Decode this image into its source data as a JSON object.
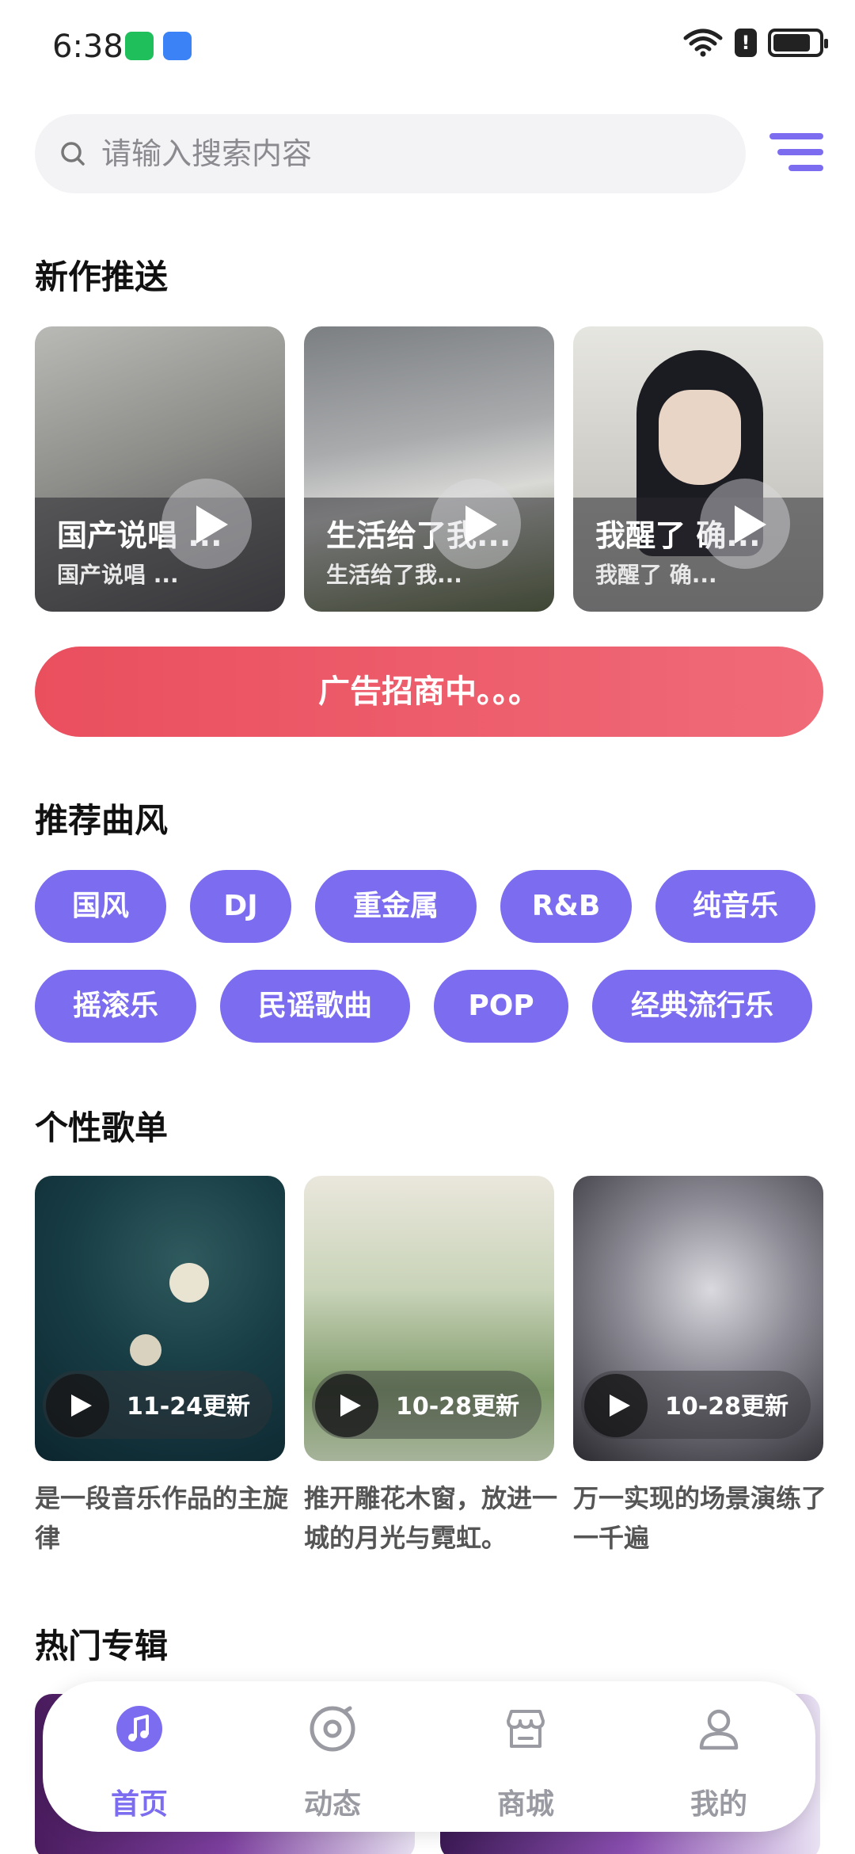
{
  "status_bar": {
    "time": "6:38"
  },
  "search": {
    "placeholder": "请输入搜索内容"
  },
  "sections": {
    "new_works": "新作推送",
    "recommended_styles": "推荐曲风",
    "personal_playlists": "个性歌单",
    "hot_albums": "热门专辑"
  },
  "new_works": [
    {
      "title": "国产说唱 ...",
      "subtitle": "国产说唱 ..."
    },
    {
      "title": "生活给了我...",
      "subtitle": "生活给了我..."
    },
    {
      "title": "我醒了 确...",
      "subtitle": "我醒了 确..."
    }
  ],
  "ad_banner": "广告招商中。。。",
  "genres": [
    "国风",
    "DJ",
    "重金属",
    "R&B",
    "纯音乐",
    "摇滚乐",
    "民谣歌曲",
    "POP",
    "经典流行乐"
  ],
  "playlists": [
    {
      "date": "11-24更新",
      "description": "是一段音乐作品的主旋律"
    },
    {
      "date": "10-28更新",
      "description": "推开雕花木窗，放进一城的月光与霓虹。"
    },
    {
      "date": "10-28更新",
      "description": "万一实现的场景演练了一千遍"
    }
  ],
  "bottom_nav": [
    {
      "label": "首页",
      "icon": "music-note-icon",
      "active": true
    },
    {
      "label": "动态",
      "icon": "disc-icon",
      "active": false
    },
    {
      "label": "商城",
      "icon": "store-icon",
      "active": false
    },
    {
      "label": "我的",
      "icon": "user-icon",
      "active": false
    }
  ],
  "colors": {
    "accent": "#7b6cf0",
    "ad": "#ea4f5e"
  }
}
